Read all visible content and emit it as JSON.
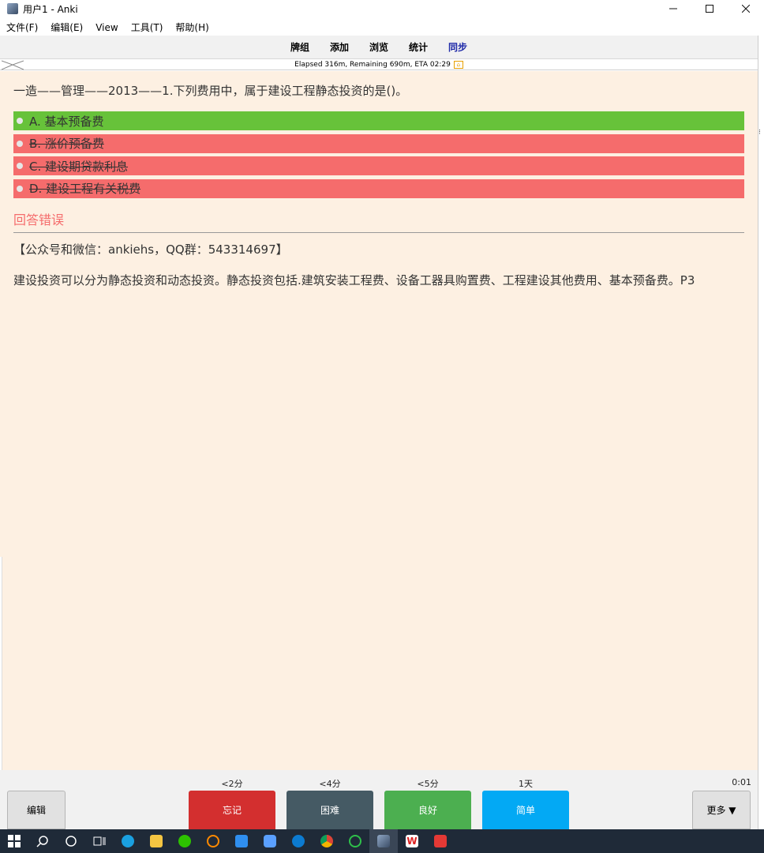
{
  "window": {
    "title": "用户1 - Anki"
  },
  "menu": [
    "文件(F)",
    "编辑(E)",
    "View",
    "工具(T)",
    "帮助(H)"
  ],
  "toolbar": {
    "decks": "牌组",
    "add": "添加",
    "browse": "浏览",
    "stats": "统计",
    "sync": "同步"
  },
  "status": {
    "text": "Elapsed 316m, Remaining 690m, ETA 02:29"
  },
  "card": {
    "question": "一造——管理——2013——1.下列费用中，属于建设工程静态投资的是()。",
    "options": [
      {
        "label": "A. 基本预备费",
        "state": "correct"
      },
      {
        "label": "B. 涨价预备费",
        "state": "wrong"
      },
      {
        "label": "C. 建设期贷款利息",
        "state": "wrong"
      },
      {
        "label": "D. 建设工程有关税费",
        "state": "wrong"
      }
    ],
    "result": "回答错误",
    "promo": "【公众号和微信：ankiehs，QQ群：543314697】",
    "explanation": "建设投资可以分为静态投资和动态投资。静态投资包括.建筑安装工程费、设备工器具购置费、工程建设其他费用、基本预备费。P3"
  },
  "answer_bar": {
    "edit": "编辑",
    "more": "更多 ▼",
    "timer": "0:01",
    "buttons": [
      {
        "label": "忘记",
        "due": "<2分",
        "color": "#d32f2f"
      },
      {
        "label": "困难",
        "due": "<4分",
        "color": "#455a64"
      },
      {
        "label": "良好",
        "due": "<5分",
        "color": "#4caf50"
      },
      {
        "label": "简单",
        "due": "1天",
        "color": "#03a9f4"
      }
    ]
  },
  "taskbar": {
    "icons": [
      "windows-start-icon",
      "search-icon",
      "cortana-icon",
      "task-view-icon",
      "edge-icon",
      "file-explorer-icon",
      "wechat-icon",
      "search-tool-icon",
      "app-blue-icon",
      "app-grid-icon",
      "edge-beta-icon",
      "chrome-icon",
      "app-green-icon",
      "anki-icon",
      "wps-icon",
      "app-red-icon"
    ]
  }
}
